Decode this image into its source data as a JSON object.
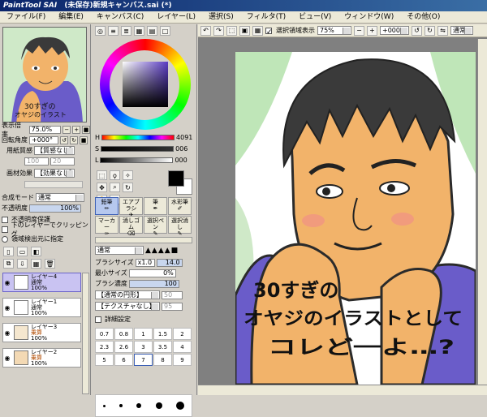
{
  "window": {
    "logo": "PaintTool SAI",
    "title": "(未保存)新規キャンバス.sai (*)"
  },
  "menu": [
    "ファイル(F)",
    "編集(E)",
    "キャンバス(C)",
    "レイヤー(L)",
    "選択(S)",
    "フィルタ(T)",
    "ビュー(V)",
    "ウィンドウ(W)",
    "その他(O)"
  ],
  "navigator": {
    "zoom_label": "表示倍率",
    "zoom_value": "75.0%",
    "angle_label": "回転角度",
    "angle_value": "+000°"
  },
  "paper": {
    "texture_label": "用紙質感",
    "texture_value": "【質感なし】",
    "effect_label": "画材効果",
    "effect_value": "【効果なし】",
    "val1": "100",
    "val2": "20"
  },
  "layer_panel": {
    "blend_label": "合成モード",
    "blend_value": "通常",
    "opacity_label": "不透明度",
    "opacity_value": "100%",
    "opt1": "不透明度保護",
    "opt2": "下のレイヤーでクリッピング",
    "opt3": "領域検出元に指定",
    "layers": [
      {
        "name": "レイヤー4",
        "mode": "通常",
        "opacity": "100%"
      },
      {
        "name": "レイヤー1",
        "mode": "通常",
        "opacity": "100%"
      },
      {
        "name": "レイヤー3",
        "mode": "乗算",
        "opacity": "100%"
      },
      {
        "name": "レイヤー2",
        "mode": "乗算",
        "opacity": "100%"
      }
    ]
  },
  "color": {
    "h_label": "H",
    "h_value": "4091",
    "s_label": "S",
    "s_value": "006",
    "l_label": "L",
    "l_value": "000"
  },
  "tools": [
    {
      "label": "鉛筆"
    },
    {
      "label": "エアブラシ"
    },
    {
      "label": "筆"
    },
    {
      "label": "水彩筆"
    },
    {
      "label": "マーカー"
    },
    {
      "label": "消しゴム"
    },
    {
      "label": "選択ペン"
    },
    {
      "label": "選択消し"
    }
  ],
  "brush": {
    "mode_value": "通常",
    "size_label": "ブラシサイズ",
    "size_mult": "x1.0",
    "size_value": "14.0",
    "min_label": "最小サイズ",
    "min_value": "0%",
    "density_label": "ブラシ濃度",
    "density_value": "100",
    "shape_value": "【通常の円形】",
    "shape_num": "50",
    "texture_value": "【テクスチャなし】",
    "texture_num": "95",
    "detail_label": "詳細設定",
    "sizes": [
      "0.7",
      "0.8",
      "1",
      "1.5",
      "2",
      "2.3",
      "2.6",
      "3",
      "3.5",
      "4",
      "5",
      "6",
      "7",
      "8",
      "9"
    ]
  },
  "canvas_toolbar": {
    "select_label": "選択領域表示",
    "zoom": "75%",
    "angle": "+000°",
    "mode": "通常"
  },
  "artwork": {
    "line1": "30すぎの",
    "line2": "オヤジのイラストとして",
    "line3": "コレど一よ…?"
  },
  "colors": {
    "accent": "#0a246a",
    "panel": "#d4d0c8",
    "sweater": "#6a5cc9",
    "skin": "#f2b36a",
    "hair": "#3a3a3a",
    "bg_green": "#bfe6b8"
  }
}
